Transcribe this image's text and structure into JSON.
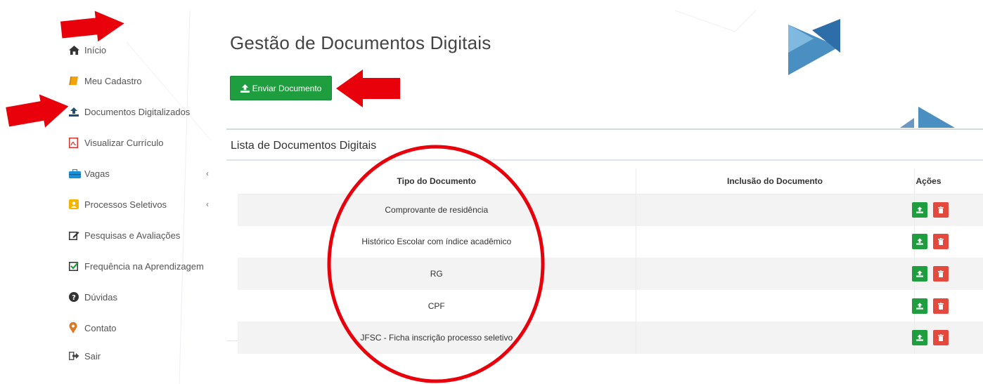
{
  "sidebar": {
    "items": [
      {
        "label": "Início",
        "icon": "home-icon",
        "has_caret": false
      },
      {
        "label": "Meu Cadastro",
        "icon": "book-icon",
        "has_caret": false
      },
      {
        "label": "Documentos Digitalizados",
        "icon": "upload-icon",
        "has_caret": false
      },
      {
        "label": "Visualizar Currículo",
        "icon": "pdf-file-icon",
        "has_caret": false
      },
      {
        "label": "Vagas",
        "icon": "briefcase-icon",
        "has_caret": true
      },
      {
        "label": "Processos Seletivos",
        "icon": "badge-icon",
        "has_caret": true
      },
      {
        "label": "Pesquisas e Avaliações",
        "icon": "edit-icon",
        "has_caret": false
      },
      {
        "label": "Frequência na Aprendizagem",
        "icon": "check-square-icon",
        "has_caret": false
      },
      {
        "label": "Dúvidas",
        "icon": "question-circle-icon",
        "has_caret": false
      },
      {
        "label": "Contato",
        "icon": "map-marker-icon",
        "has_caret": false
      },
      {
        "label": "Sair",
        "icon": "sign-out-icon",
        "has_caret": false
      }
    ],
    "caret": "‹"
  },
  "main": {
    "title": "Gestão de Documentos Digitais",
    "send_button_label": "Enviar Documento",
    "panel_title": "Lista de Documentos Digitais",
    "table": {
      "headers": [
        "Tipo do Documento",
        "Inclusão do Documento",
        "Ações"
      ],
      "rows": [
        {
          "tipo": "Comprovante de residência",
          "inclusao": ""
        },
        {
          "tipo": "Histórico Escolar com índice acadêmico",
          "inclusao": ""
        },
        {
          "tipo": "RG",
          "inclusao": ""
        },
        {
          "tipo": "CPF",
          "inclusao": ""
        },
        {
          "tipo": "JFSC - Ficha inscrição processo seletivo",
          "inclusao": ""
        }
      ]
    }
  },
  "colors": {
    "primary_green": "#1e9e3e",
    "danger_red": "#e34a3d",
    "annotation_red": "#e8000b",
    "logo_blue": "#4a8fc2"
  }
}
